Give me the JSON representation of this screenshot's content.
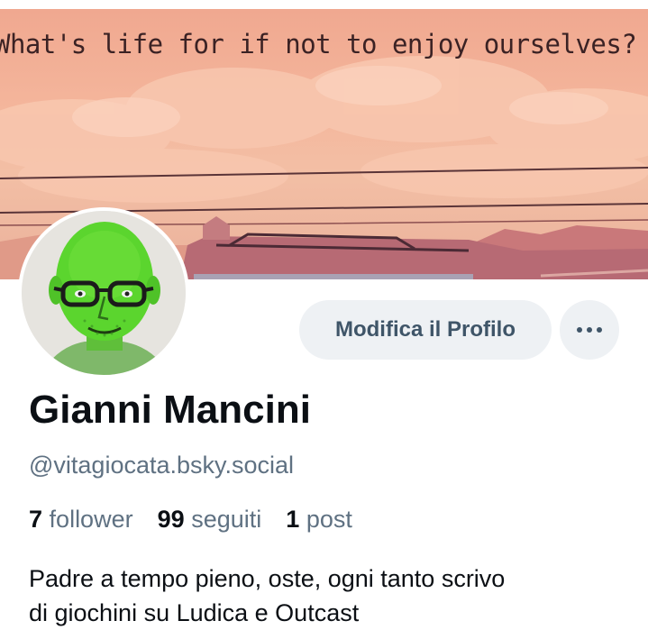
{
  "banner": {
    "caption": "What's life for if not to enjoy ourselves? ◆",
    "sky_color": "#f4b59b",
    "text_color": "#3b2224"
  },
  "profile": {
    "display_name": "Gianni Mancini",
    "handle": "@vitagiocata.bsky.social",
    "avatar_icon": "avatar-green-face",
    "bio_lines": [
      "Padre a tempo pieno, oste, ogni tanto scrivo",
      "di giochini su Ludica e Outcast"
    ]
  },
  "actions": {
    "edit_profile_label": "Modifica il Profilo",
    "more_icon": "ellipsis-icon"
  },
  "stats": {
    "followers_count": "7",
    "followers_label": "follower",
    "following_count": "99",
    "following_label": "seguiti",
    "posts_count": "1",
    "posts_label": "post"
  },
  "colors": {
    "button_bg": "#eef1f4",
    "button_text": "#3f5568",
    "secondary_text": "#5f7182",
    "primary_text": "#0b0f14"
  }
}
